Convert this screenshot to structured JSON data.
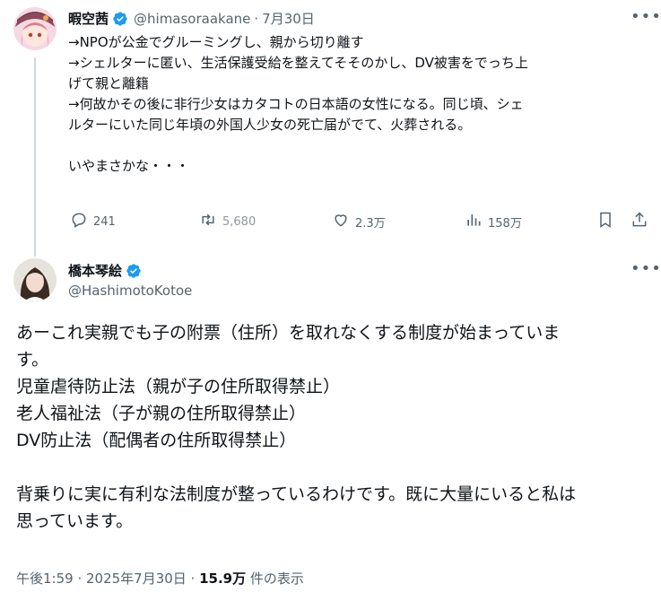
{
  "tweet1": {
    "display_name": "暇空茜",
    "handle": "@himasoraakane",
    "separator": "·",
    "date": "7月30日",
    "text": "→NPOが公金でグルーミングし、親から切り離す\n→シェルターに匿い、生活保護受給を整えてそそのかし、DV被害をでっち上\nげて親と離籍\n→何故かその後に非行少女はカタコトの日本語の女性になる。同じ頃、シェ\nルターにいた同じ年頃の外国人少女の死亡届がでて、火葬される。\n\nいやまさかな・・・",
    "replies": "241",
    "retweets": "5,680",
    "likes": "2.3万",
    "views": "158万",
    "more": "•••"
  },
  "tweet2": {
    "display_name": "橋本琴絵",
    "handle": "@HashimotoKotoe",
    "more": "•••",
    "text": "あーこれ実親でも子の附票（住所）を取れなくする制度が始まっていま\nす。\n児童虐待防止法（親が子の住所取得禁止）\n老人福祉法（子が親の住所取得禁止）\nDV防止法（配偶者の住所取得禁止）\n\n背乗りに実に有利な法制度が整っているわけです。既に大量にいると私は\n思っています。",
    "timestamp": "午後1:59 · 2025年7月30日 · ",
    "views_count": "15.9万",
    "views_label": " 件の表示"
  },
  "colors": {
    "verified": "#1d9bf0",
    "secondary_text": "#536471",
    "primary_text": "#0f1419",
    "thread_line": "#cfd9de"
  }
}
